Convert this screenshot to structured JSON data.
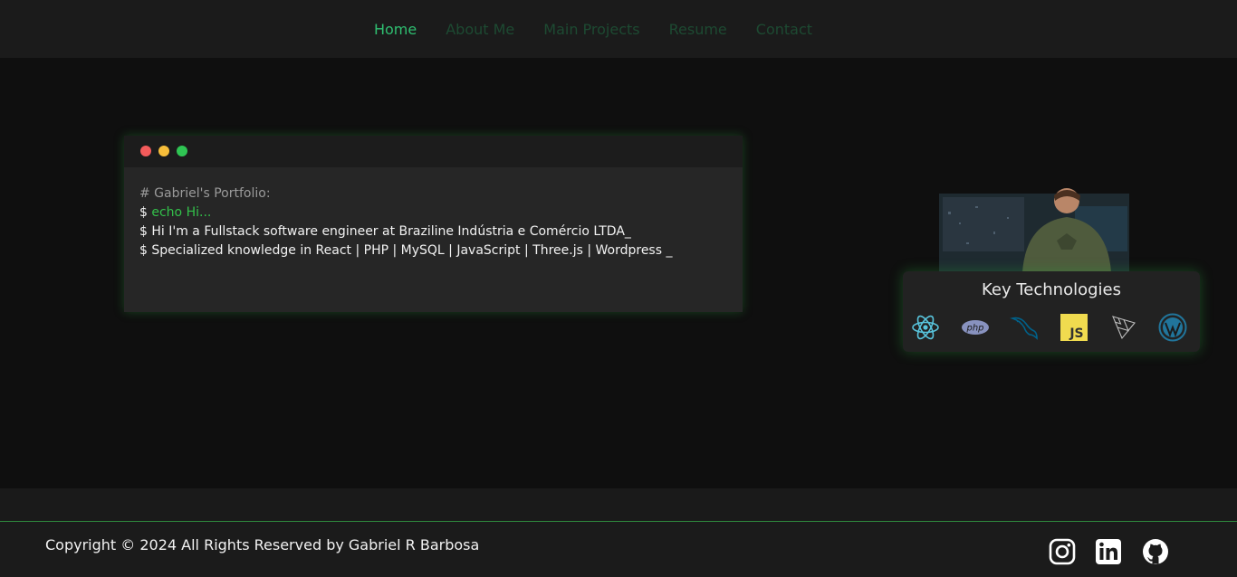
{
  "nav": {
    "items": [
      {
        "label": "Home",
        "active": true
      },
      {
        "label": "About Me",
        "active": false
      },
      {
        "label": "Main Projects",
        "active": false
      },
      {
        "label": "Resume",
        "active": false
      },
      {
        "label": "Contact",
        "active": false
      }
    ]
  },
  "terminal": {
    "comment": "# Gabriel's Portfolio:",
    "prompt": "$",
    "echo": "echo Hi...",
    "line1": "$ Hi I'm a Fullstack software engineer at Braziline Indústria e Comércio LTDA_",
    "line2": "$ Specialized knowledge in React | PHP | MySQL | JavaScript | Three.js | Wordpress _"
  },
  "tech": {
    "title": "Key Technologies",
    "icons": [
      "react-icon",
      "php-icon",
      "mysql-icon",
      "javascript-icon",
      "threejs-icon",
      "wordpress-icon"
    ],
    "php_text": "php",
    "js_text": "JS"
  },
  "footer": {
    "copyright": "Copyright © 2024 All Rights Reserved by Gabriel R Barbosa",
    "social": [
      "instagram-icon",
      "linkedin-icon",
      "github-icon"
    ]
  },
  "colors": {
    "accent": "#2fbf71",
    "nav_inactive": "#1d4a32",
    "echo_green": "#33c04a",
    "background": "#0f0f0f"
  }
}
